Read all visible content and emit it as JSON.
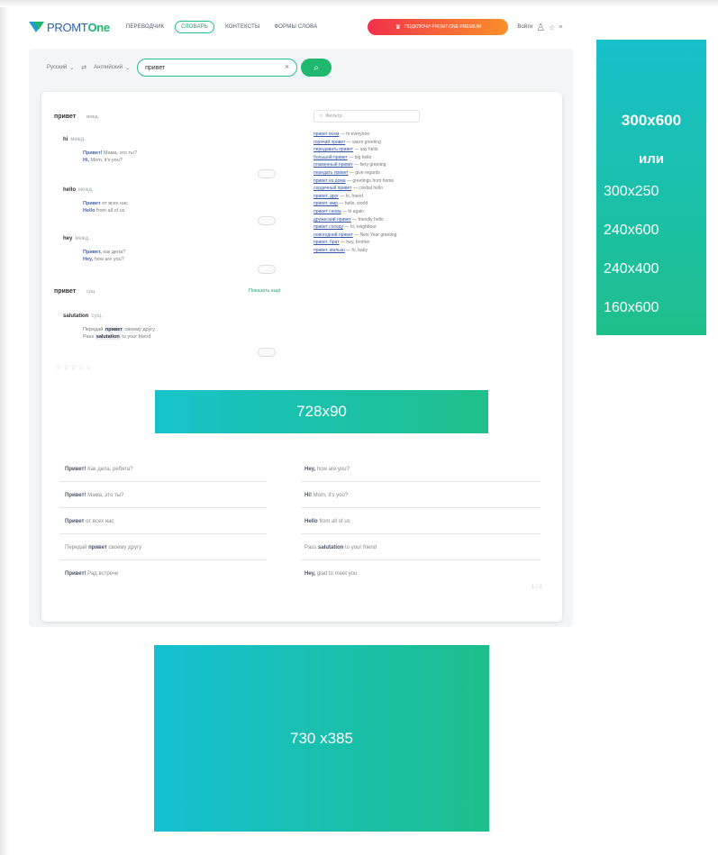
{
  "header": {
    "logo_text": "PROMT",
    "logo_accent": "One",
    "nav": [
      "ПЕРЕВОДЧИК",
      "СЛОВАРЬ",
      "КОНТЕКСТЫ",
      "ФОРМЫ СЛОВА"
    ],
    "premium_label": "ПОДКЛЮЧИ PROMT.ONE PREMIUM",
    "login_label": "Войти",
    "icons": [
      "user-icon",
      "star-icon",
      "menu-icon",
      "crown-icon"
    ]
  },
  "search": {
    "from_lang": "Русский",
    "to_lang": "Английский",
    "query": "привет",
    "clear": "×",
    "search_icon": "⌕"
  },
  "entries": [
    {
      "word": "привет",
      "pos": "межд.",
      "translations": [
        {
          "word": "hi",
          "pos": "межд.",
          "examples": [
            [
              "Привет!",
              " Мама, это ты?"
            ],
            [
              "Hi,",
              " Mom, it's you?"
            ]
          ]
        },
        {
          "word": "hello",
          "pos": "межд.",
          "examples": [
            [
              "Привет",
              " от всех нас"
            ],
            [
              "Hello",
              " from all of us"
            ]
          ]
        },
        {
          "word": "hey",
          "pos": "межд.",
          "examples": [
            [
              "Привет,",
              " как дела?"
            ],
            [
              "Hey,",
              " how are you?"
            ]
          ]
        }
      ]
    },
    {
      "word": "привет",
      "pos": "сущ.",
      "more": "Показать ещё",
      "translations": [
        {
          "word": "salutation",
          "pos": "сущ.",
          "examples": [
            [
              "Передай ",
              "привет",
              " своему другу"
            ],
            [
              "Pass ",
              "salutation",
              " to your friend"
            ]
          ]
        }
      ]
    }
  ],
  "filter_placeholder": "Фильтр",
  "phrases": [
    [
      "привет всем",
      " — hi everyone"
    ],
    [
      "горячий привет",
      " — warm greeting"
    ],
    [
      "передавать привет",
      " — say hello"
    ],
    [
      "большой привет",
      " — big hello"
    ],
    [
      "пламенный привет",
      " — fiery greeting"
    ],
    [
      "передать привет",
      " — give regards"
    ],
    [
      "привет из дома",
      " — greetings from home"
    ],
    [
      "сердечный привет",
      " — cordial hello"
    ],
    [
      "привет, друг",
      " — hi, friend"
    ],
    [
      "привет, мир",
      " — hello, world"
    ],
    [
      "привет снова",
      " — hi again"
    ],
    [
      "дружеский привет",
      " — friendly hello"
    ],
    [
      "привет соседу",
      " — hi, neighbour"
    ],
    [
      "новогодний привет",
      " — New Year greeting"
    ],
    [
      "привет, брат",
      " — hey, brother"
    ],
    [
      "привет, малыш",
      " — hi, baby"
    ]
  ],
  "rating": "☆☆☆☆☆",
  "contexts": {
    "left": [
      [
        "Привет!",
        " Как дела, ребята?"
      ],
      [
        "Привет!",
        " Мама, это ты?"
      ],
      [
        "Привет",
        " от всех нас"
      ],
      [
        "Передай ",
        "привет",
        " своему другу"
      ],
      [
        "Привет!",
        " Рад встрече"
      ]
    ],
    "right": [
      [
        "Hey,",
        " how are you?"
      ],
      [
        "Hi!",
        " Mom, it's you?"
      ],
      [
        "Hello",
        " from all of us"
      ],
      [
        "Pass ",
        "salutation",
        " to your friend"
      ],
      [
        "Hey,",
        " glad to meet you"
      ]
    ]
  },
  "pager": "1 / 2",
  "ads": {
    "leaderboard": "728x90",
    "side_main": "300x600",
    "side_or": "или",
    "side_sizes": [
      "300x250",
      "240x600",
      "240x400",
      "160x600"
    ],
    "bottom": "730 x385"
  },
  "colors": {
    "accent_green": "#1eb86f",
    "brand_blue": "#2c62a8",
    "premium_red": "#f0304a",
    "ad_teal": "#17c0cb"
  }
}
